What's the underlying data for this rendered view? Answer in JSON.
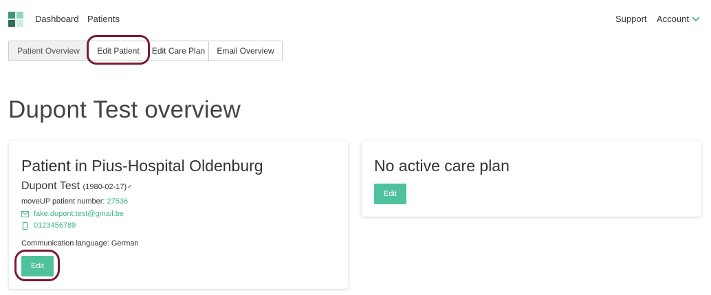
{
  "nav": {
    "links": [
      "Dashboard",
      "Patients"
    ],
    "support": "Support",
    "account": "Account"
  },
  "tabs": [
    "Patient Overview",
    "Edit Patient",
    "Edit Care Plan",
    "Email Overview"
  ],
  "page": {
    "title": "Dupont Test overview"
  },
  "patient_card": {
    "title": "Patient in Pius-Hospital Oldenburg",
    "name": "Dupont Test",
    "dob": "(1980-02-17)",
    "gender_symbol": "♂",
    "number_label": "moveUP patient number: ",
    "number": "27536",
    "email": "fake.dupont.test@gmail.be",
    "phone": "0123456789",
    "language": "Communication language: German",
    "edit_label": "Edit"
  },
  "careplan_card": {
    "title": "No active care plan",
    "edit_label": "Edit"
  },
  "colors": {
    "accent": "#4fc19c",
    "link": "#3eb38f",
    "highlight": "#7b1a2e"
  }
}
